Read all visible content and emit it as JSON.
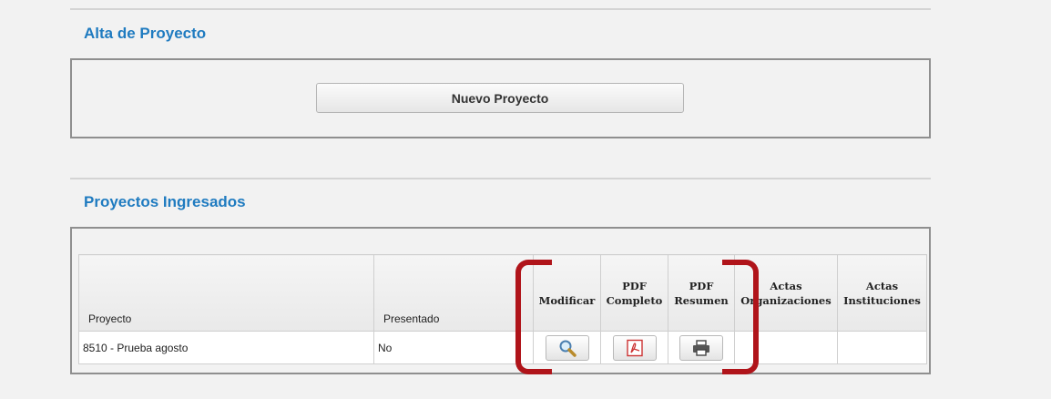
{
  "alta": {
    "title": "Alta de Proyecto",
    "new_button": "Nuevo Proyecto"
  },
  "ingresados": {
    "title": "Proyectos Ingresados",
    "columns": {
      "proyecto": "Proyecto",
      "presentado": "Presentado",
      "modificar": "Modificar",
      "pdf_completo_1": "PDF",
      "pdf_completo_2": "Completo",
      "pdf_resumen_1": "PDF",
      "pdf_resumen_2": "Resumen",
      "actas_org_1": "Actas",
      "actas_org_2": "Organizaciones",
      "actas_inst_1": "Actas",
      "actas_inst_2": "Instituciones"
    },
    "rows": [
      {
        "proyecto": "8510 - Prueba agosto",
        "presentado": "No"
      }
    ]
  },
  "icons": {
    "modificar": "magnifier-icon",
    "pdf_completo": "pdf-icon",
    "pdf_resumen": "printer-icon"
  },
  "colors": {
    "section_title": "#1f7bc0",
    "highlight": "#b0141a"
  }
}
